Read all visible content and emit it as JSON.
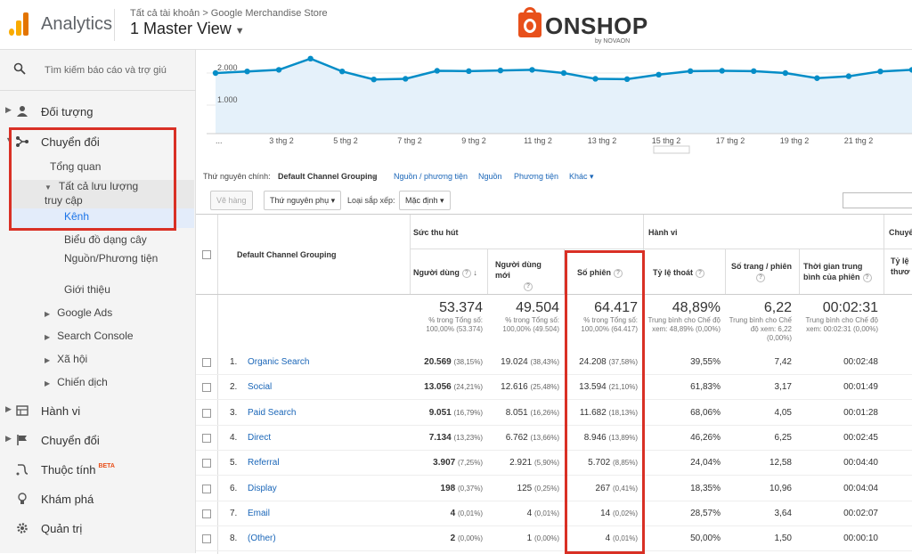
{
  "header": {
    "app_name": "Analytics",
    "breadcrumb": "Tất cả tài khoản > Google Merchandise Store",
    "view_name": "1 Master View",
    "logo_text": "ONSHOP",
    "logo_by": "by NOVAON"
  },
  "sidebar": {
    "search_placeholder": "Tìm kiếm báo cáo và trợ giú",
    "items": {
      "audience": "Đối tượng",
      "conversion": "Chuyển đổi",
      "overview": "Tổng quan",
      "all_traffic": "Tất cả lưu lượng truy cập",
      "channels": "Kênh",
      "treemap": "Biểu đồ dạng cây",
      "source_medium": "Nguồn/Phương tiện",
      "referrals": "Giới thiệu",
      "google_ads": "Google Ads",
      "search_console": "Search Console",
      "social": "Xã hội",
      "campaigns": "Chiến dịch",
      "behavior": "Hành vi",
      "conversions": "Chuyển đổi",
      "attribution": "Thuộc tính",
      "attribution_badge": "BETA",
      "discover": "Khám phá",
      "admin": "Quản trị"
    }
  },
  "chart_data": {
    "type": "line",
    "y_tick_labels": [
      "2.000",
      "1.000"
    ],
    "x_tick_labels": [
      "...",
      "3 thg 2",
      "5 thg 2",
      "7 thg 2",
      "9 thg 2",
      "11 thg 2",
      "13 thg 2",
      "15 thg 2",
      "17 thg 2",
      "19 thg 2",
      "21 thg 2"
    ],
    "values": [
      2000,
      2050,
      2100,
      2450,
      2050,
      1800,
      1820,
      2070,
      2060,
      2080,
      2100,
      2000,
      1820,
      1810,
      1950,
      2060,
      2070,
      2060,
      2000,
      1840,
      1900,
      2050,
      2100
    ],
    "line_color": "#058dc7",
    "fill_color": "#e5f1fa"
  },
  "dimension_bar": {
    "primary_label": "Thứ nguyên chính:",
    "primary_value": "Default Channel Grouping",
    "links": [
      "Nguồn / phương tiện",
      "Nguồn",
      "Phương tiện",
      "Khác"
    ]
  },
  "toolbar": {
    "plot_rows": "Vẽ hàng",
    "secondary_dim": "Thứ nguyên phụ",
    "sort_type_label": "Loại sắp xếp:",
    "sort_value": "Mặc định"
  },
  "table": {
    "group_acquisition": "Sức thu hút",
    "group_behavior": "Hành vi",
    "group_conversion": "Chuyể",
    "dim_header": "Default Channel Grouping",
    "columns": {
      "users": "Người dùng",
      "new_users": "Người dùng mới",
      "sessions": "Số phiên",
      "bounce": "Tỷ lệ thoát",
      "pages": "Số trang / phiên",
      "duration": "Thời gian trung bình của phiên",
      "conv": "Tỷ lệ thươ"
    },
    "totals": {
      "users": "53.374",
      "users_sub": "% trong Tổng số: 100,00% (53.374)",
      "new_users": "49.504",
      "new_users_sub": "% trong Tổng số: 100,00% (49.504)",
      "sessions": "64.417",
      "sessions_sub": "% trong Tổng số: 100,00% (64.417)",
      "bounce": "48,89%",
      "bounce_sub": "Trung bình cho Chế độ xem: 48,89% (0,00%)",
      "pages": "6,22",
      "pages_sub": "Trung bình cho Chế độ xem: 6,22 (0,00%)",
      "duration": "00:02:31",
      "duration_sub": "Trung bình cho Chế độ xem: 00:02:31 (0,00%)"
    },
    "rows": [
      {
        "n": "1.",
        "name": "Organic Search",
        "users": "20.569",
        "users_pct": "(38,15%)",
        "new": "19.024",
        "new_pct": "(38,43%)",
        "sess": "24.208",
        "sess_pct": "(37,58%)",
        "bounce": "39,55%",
        "pages": "7,42",
        "dur": "00:02:48"
      },
      {
        "n": "2.",
        "name": "Social",
        "users": "13.056",
        "users_pct": "(24,21%)",
        "new": "12.616",
        "new_pct": "(25,48%)",
        "sess": "13.594",
        "sess_pct": "(21,10%)",
        "bounce": "61,83%",
        "pages": "3,17",
        "dur": "00:01:49"
      },
      {
        "n": "3.",
        "name": "Paid Search",
        "users": "9.051",
        "users_pct": "(16,79%)",
        "new": "8.051",
        "new_pct": "(16,26%)",
        "sess": "11.682",
        "sess_pct": "(18,13%)",
        "bounce": "68,06%",
        "pages": "4,05",
        "dur": "00:01:28"
      },
      {
        "n": "4.",
        "name": "Direct",
        "users": "7.134",
        "users_pct": "(13,23%)",
        "new": "6.762",
        "new_pct": "(13,66%)",
        "sess": "8.946",
        "sess_pct": "(13,89%)",
        "bounce": "46,26%",
        "pages": "6,25",
        "dur": "00:02:45"
      },
      {
        "n": "5.",
        "name": "Referral",
        "users": "3.907",
        "users_pct": "(7,25%)",
        "new": "2.921",
        "new_pct": "(5,90%)",
        "sess": "5.702",
        "sess_pct": "(8,85%)",
        "bounce": "24,04%",
        "pages": "12,58",
        "dur": "00:04:40"
      },
      {
        "n": "6.",
        "name": "Display",
        "users": "198",
        "users_pct": "(0,37%)",
        "new": "125",
        "new_pct": "(0,25%)",
        "sess": "267",
        "sess_pct": "(0,41%)",
        "bounce": "18,35%",
        "pages": "10,96",
        "dur": "00:04:04"
      },
      {
        "n": "7.",
        "name": "Email",
        "users": "4",
        "users_pct": "(0,01%)",
        "new": "4",
        "new_pct": "(0,01%)",
        "sess": "14",
        "sess_pct": "(0,02%)",
        "bounce": "28,57%",
        "pages": "3,64",
        "dur": "00:02:07"
      },
      {
        "n": "8.",
        "name": "(Other)",
        "users": "2",
        "users_pct": "(0,00%)",
        "new": "1",
        "new_pct": "(0,00%)",
        "sess": "4",
        "sess_pct": "(0,01%)",
        "bounce": "50,00%",
        "pages": "1,50",
        "dur": "00:00:10"
      }
    ]
  }
}
